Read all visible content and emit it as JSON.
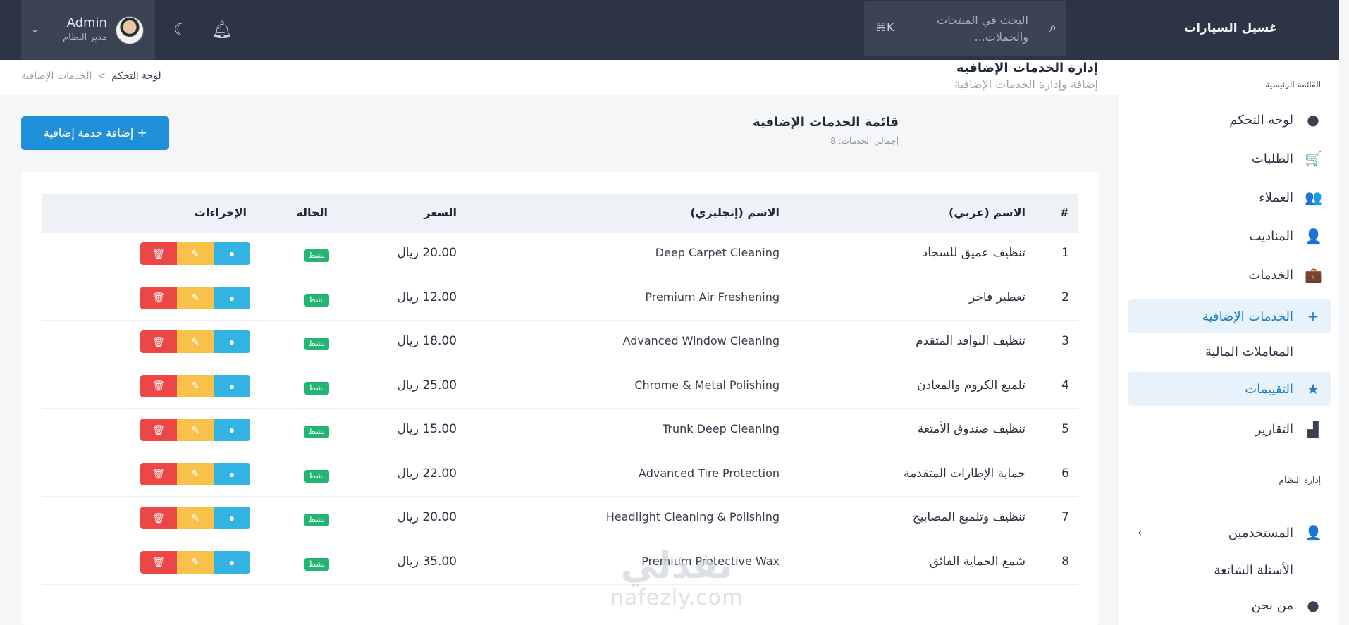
{
  "header": {
    "brand": "غسيل السيارات",
    "search_placeholder": "البحث في المنتجات والحملات...",
    "search_shortcut": "⌘K",
    "user_name": "Admin",
    "user_role": "مدير النظام"
  },
  "breadcrumb": {
    "home": "لوحة التحكم",
    "current": "الخدمات الإضافية",
    "separator": "<"
  },
  "page": {
    "title": "إدارة الخدمات الإضافية",
    "subtitle": "إضافة وإدارة الخدمات الإضافية",
    "list_title": "قائمة الخدمات الإضافية",
    "list_count": "إجمالي الخدمات: 8",
    "add_button": "إضافة خدمة إضافية",
    "add_icon": "+"
  },
  "sidebar": {
    "section_main": "القائمة الرئيسية",
    "section_admin": "إدارة النظام",
    "items": [
      {
        "label": "لوحة التحكم",
        "icon": "dashboard-icon",
        "glyph": "●"
      },
      {
        "label": "الطلبات",
        "icon": "cart-icon",
        "glyph": "🛒"
      },
      {
        "label": "العملاء",
        "icon": "customers-icon",
        "glyph": "👥"
      },
      {
        "label": "المناديب",
        "icon": "delegates-icon",
        "glyph": "👤"
      },
      {
        "label": "الخدمات",
        "icon": "briefcase-icon",
        "glyph": "💼"
      },
      {
        "label": "الخدمات الإضافية",
        "icon": "plus-icon",
        "glyph": "+"
      },
      {
        "label": "المعاملات المالية",
        "icon": "",
        "glyph": ""
      },
      {
        "label": "التقييمات",
        "icon": "star-icon",
        "glyph": "★"
      },
      {
        "label": "التقارير",
        "icon": "reports-icon",
        "glyph": "▟"
      },
      {
        "label": "المستخدمين",
        "icon": "user-icon",
        "glyph": "👤"
      },
      {
        "label": "الأسئلة الشائعة",
        "icon": "",
        "glyph": ""
      },
      {
        "label": "من نحن",
        "icon": "info-icon",
        "glyph": "●"
      }
    ],
    "active": [
      5,
      7
    ]
  },
  "table": {
    "headers": {
      "num": "#",
      "name_ar": "الاسم (عربي)",
      "name_en": "الاسم (إنجليزي)",
      "price": "السعر",
      "status": "الحالة",
      "actions": "الإجراءات"
    },
    "rows": [
      {
        "num": "1",
        "name_ar": "تنظيف عميق للسجاد",
        "name_en": "Deep Carpet Cleaning",
        "price": "20.00 ريال",
        "status": "نشط"
      },
      {
        "num": "2",
        "name_ar": "تعطير فاخر",
        "name_en": "Premium Air Freshening",
        "price": "12.00 ريال",
        "status": "نشط"
      },
      {
        "num": "3",
        "name_ar": "تنظيف النوافذ المتقدم",
        "name_en": "Advanced Window Cleaning",
        "price": "18.00 ريال",
        "status": "نشط"
      },
      {
        "num": "4",
        "name_ar": "تلميع الكروم والمعادن",
        "name_en": "Chrome & Metal Polishing",
        "price": "25.00 ريال",
        "status": "نشط"
      },
      {
        "num": "5",
        "name_ar": "تنظيف صندوق الأمتعة",
        "name_en": "Trunk Deep Cleaning",
        "price": "15.00 ريال",
        "status": "نشط"
      },
      {
        "num": "6",
        "name_ar": "حماية الإطارات المتقدمة",
        "name_en": "Advanced Tire Protection",
        "price": "22.00 ريال",
        "status": "نشط"
      },
      {
        "num": "7",
        "name_ar": "تنظيف وتلميع المصابيح",
        "name_en": "Headlight Cleaning & Polishing",
        "price": "20.00 ريال",
        "status": "نشط"
      },
      {
        "num": "8",
        "name_ar": "شمع الحماية الفائق",
        "name_en": "Premium Protective Wax",
        "price": "35.00 ريال",
        "status": "نشط"
      }
    ]
  },
  "watermark": {
    "line1": "نفذلي",
    "line2": "nafezly.com"
  },
  "colors": {
    "header_bg": "#2d3445",
    "accent": "#1e8fd8",
    "status_active": "#22b573",
    "delete": "#ec4646",
    "edit": "#f8c14a",
    "view": "#33b2e4"
  }
}
